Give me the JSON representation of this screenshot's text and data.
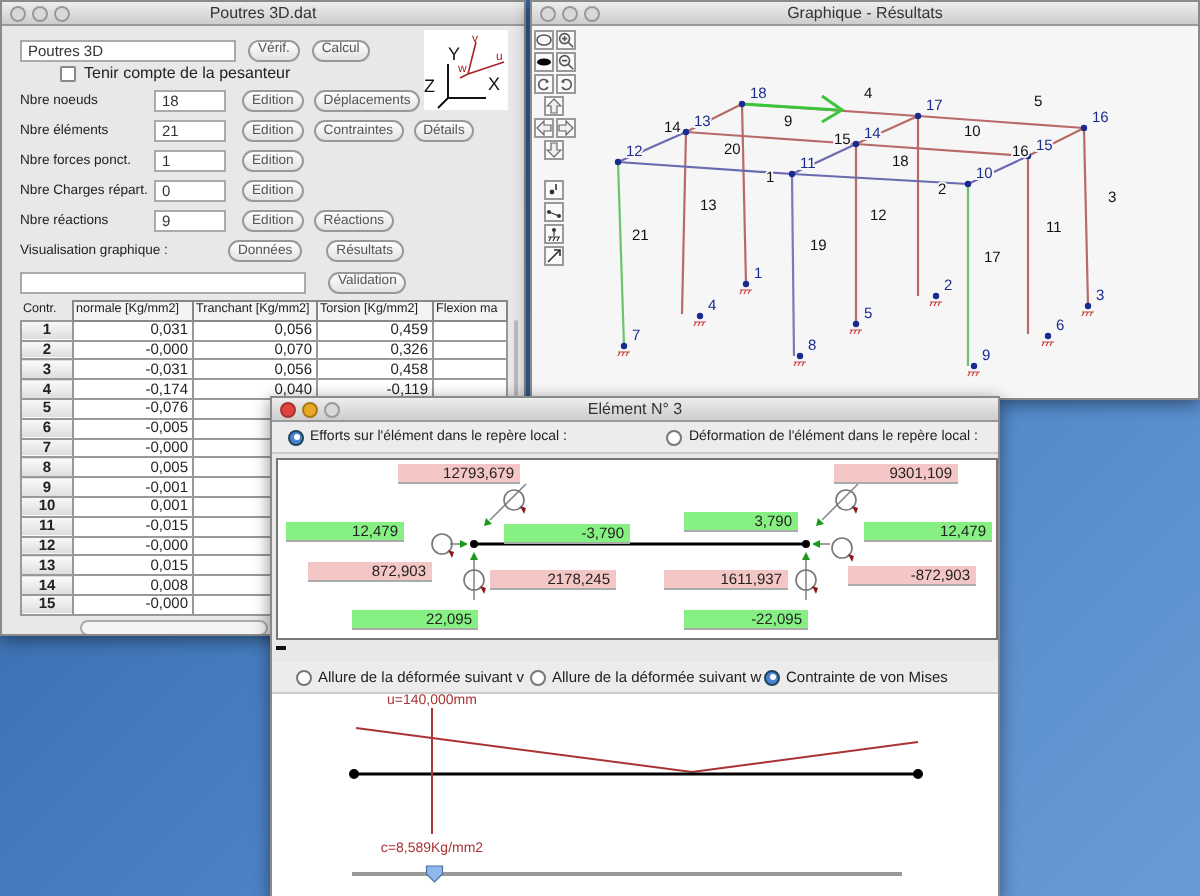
{
  "poutres_window": {
    "title": "Poutres 3D.dat",
    "active": false,
    "name_field": {
      "value": "Poutres 3D"
    },
    "top_buttons": [
      "Vérif.",
      "Calcul"
    ],
    "axes_labels": [
      "Y",
      "Z",
      "X",
      "v",
      "w",
      "u"
    ],
    "gravity_checkbox": {
      "label": "Tenir compte de la pesanteur",
      "checked": false
    },
    "count_rows": [
      {
        "label": "Nbre noeuds",
        "value": "18",
        "buttons": [
          "Edition",
          "Déplacements"
        ]
      },
      {
        "label": "Nbre éléments",
        "value": "21",
        "buttons": [
          "Edition",
          "Contraintes",
          "Détails"
        ]
      },
      {
        "label": "Nbre forces ponct.",
        "value": "1",
        "buttons": [
          "Edition"
        ]
      },
      {
        "label": "Nbre Charges répart.",
        "value": "0",
        "buttons": [
          "Edition"
        ]
      },
      {
        "label": "Nbre réactions",
        "value": "9",
        "buttons": [
          "Edition",
          "Réactions"
        ]
      }
    ],
    "visualisation": {
      "label": "Visualisation graphique :",
      "buttons": [
        "Données",
        "Résultats"
      ]
    },
    "validation_button": "Validation",
    "table": {
      "columns": [
        "Contr.",
        "normale [Kg/mm2]",
        "Tranchant [Kg/mm2]",
        "Torsion [Kg/mm2]",
        "Flexion ma"
      ],
      "rows": [
        {
          "cells": [
            "1",
            "0,031",
            "0,056",
            "0,459"
          ]
        },
        {
          "cells": [
            "2",
            "-0,000",
            "0,070",
            "0,326"
          ]
        },
        {
          "cells": [
            "3",
            "-0,031",
            "0,056",
            "0,458"
          ]
        },
        {
          "cells": [
            "4",
            "-0,174",
            "0,040",
            "-0,119"
          ]
        },
        {
          "cells": [
            "5",
            "-0,076"
          ]
        },
        {
          "cells": [
            "6",
            "-0,005"
          ]
        },
        {
          "cells": [
            "7",
            "-0,000"
          ]
        },
        {
          "cells": [
            "8",
            "0,005"
          ]
        },
        {
          "cells": [
            "9",
            "-0,001"
          ]
        },
        {
          "cells": [
            "10",
            "0,001"
          ]
        },
        {
          "cells": [
            "11",
            "-0,015"
          ]
        },
        {
          "cells": [
            "12",
            "-0,000"
          ]
        },
        {
          "cells": [
            "13",
            "0,015"
          ]
        },
        {
          "cells": [
            "14",
            "0,008"
          ]
        },
        {
          "cells": [
            "15",
            "-0,000"
          ]
        }
      ]
    }
  },
  "graph_window": {
    "title": "Graphique - Résultats",
    "active": false,
    "node_labels": [
      "18",
      "17",
      "16",
      "13",
      "12",
      "14",
      "11",
      "15",
      "10",
      "1",
      "4",
      "7",
      "8",
      "5",
      "2",
      "9",
      "6",
      "3"
    ],
    "element_labels": [
      "4",
      "5",
      "9",
      "10",
      "20",
      "18",
      "1",
      "2",
      "3",
      "13",
      "12",
      "11",
      "21",
      "19",
      "17",
      "14",
      "15",
      "16"
    ]
  },
  "element_window": {
    "title": "Elément N° 3",
    "active": true,
    "mode_options": [
      {
        "label": "Efforts sur l'élément dans le repère local :",
        "selected": true
      },
      {
        "label": "Déformation de l'élément dans le repère local :",
        "selected": false
      }
    ],
    "force_values": [
      {
        "value": "12793,679",
        "kind": "moment"
      },
      {
        "value": "12,479",
        "kind": "force"
      },
      {
        "value": "-3,790",
        "kind": "force"
      },
      {
        "value": "872,903",
        "kind": "moment"
      },
      {
        "value": "2178,245",
        "kind": "moment"
      },
      {
        "value": "22,095",
        "kind": "force"
      },
      {
        "value": "3,790",
        "kind": "force"
      },
      {
        "value": "9301,109",
        "kind": "moment"
      },
      {
        "value": "12,479",
        "kind": "force"
      },
      {
        "value": "1611,937",
        "kind": "moment"
      },
      {
        "value": "-872,903",
        "kind": "moment"
      },
      {
        "value": "-22,095",
        "kind": "force"
      }
    ],
    "plot_options": [
      {
        "label": "Allure de la déformée suivant v",
        "selected": false
      },
      {
        "label": "Allure de la déformée suivant w",
        "selected": false
      },
      {
        "label": "Contrainte de von Mises",
        "selected": true
      }
    ],
    "plot": {
      "position_label": "u=140,000mm",
      "value_label": "c=8,589Kg/mm2",
      "slider": {
        "level": 0.15
      }
    }
  }
}
